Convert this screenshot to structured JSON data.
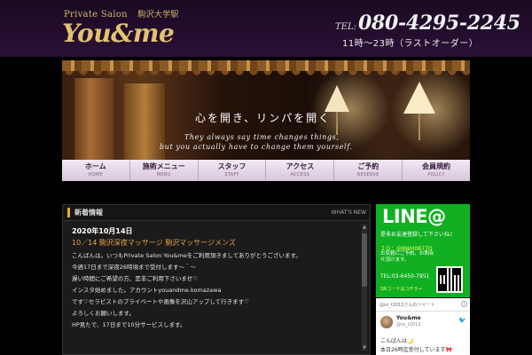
{
  "header": {
    "pre_title": "Private Salon",
    "station": "駒沢大学駅",
    "brand": "You&me",
    "tel_label": "TEL:",
    "tel": "080-4295-2245",
    "hours": "11時～23時（ラストオーダー）"
  },
  "hero": {
    "tagline": "心を開き、リンパを開く",
    "english_line1": "They always say time changes things,",
    "english_line2": "but you actually have to change them yourself."
  },
  "nav": {
    "items": [
      {
        "jp": "ホーム",
        "en": "HOME"
      },
      {
        "jp": "施術メニュー",
        "en": "MENU"
      },
      {
        "jp": "スタッフ",
        "en": "STAFF"
      },
      {
        "jp": "アクセス",
        "en": "ACCESS"
      },
      {
        "jp": "ご予約",
        "en": "RESERVE"
      },
      {
        "jp": "会員規約",
        "en": "POLICY"
      }
    ]
  },
  "news": {
    "title": "新着情報",
    "more": "WHAT'S NEW",
    "date": "2020年10月14日",
    "headline": "10／14 駒沢深夜マッサージ 駒沢マッサージメンズ",
    "lines": [
      "こんばんは。いつもPrivate Salon You&meをご利用頂きましてありがとうございます。",
      "今週17日まで深夜26時頃まで受付します",
      "遅い時間にご希望の方、是非ご利用下さいませ♡",
      "インスタ始めました。アカウントyouandme.komazawa",
      "です♡セラピストのプライベートや画像を沢山アップして行きます♡",
      "よろしくお願いします。",
      "HP見たで、17日まで10分サービスします。"
    ],
    "line2_suffix": "～＾～"
  },
  "line_box": {
    "logo": "LINE@",
    "sub": "是非お友達登録して下さいね♪",
    "id": "ＩＤ：@BWH0B77Q",
    "desc": "お気軽にご予約、お問合せ頂けます。",
    "tel": "TEL:03-6450-7951",
    "qr_note": "QRコードはコチラ→"
  },
  "twitter": {
    "handle": "@sz_t2012さんのツイート",
    "title": "ツイート",
    "info": "i",
    "name": "You&me",
    "at": "@sz_t2012",
    "bird": "🐦",
    "text1": "こんばんは🌙",
    "text2": "本日26時迄受付しています🎀"
  },
  "colors": {
    "gold": "#e2c372",
    "line_green": "#10b022",
    "nav_bg": "#e8dcea",
    "accent_orange": "#e5a04a"
  }
}
